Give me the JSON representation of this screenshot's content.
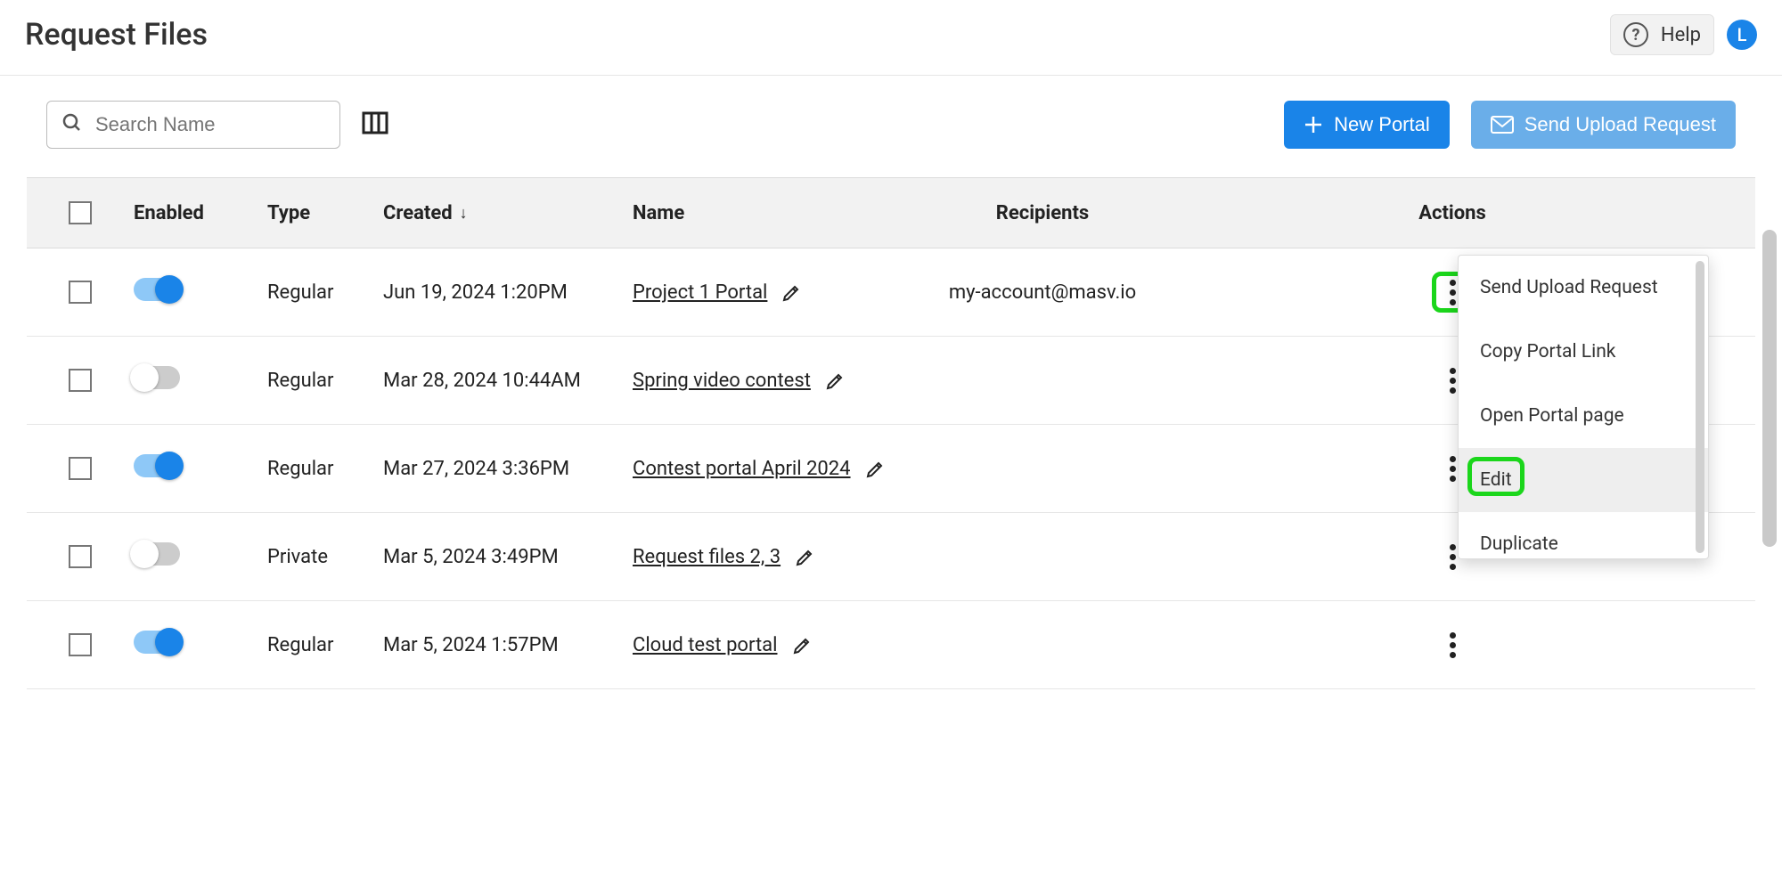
{
  "header": {
    "title": "Request Files",
    "help_label": "Help",
    "avatar_initial": "L"
  },
  "toolbar": {
    "search_placeholder": "Search Name",
    "new_portal": "New Portal",
    "send_upload": "Send Upload Request"
  },
  "table": {
    "columns": {
      "enabled": "Enabled",
      "type": "Type",
      "created": "Created",
      "name": "Name",
      "recipients": "Recipients",
      "actions": "Actions"
    },
    "rows": [
      {
        "enabled": true,
        "type": "Regular",
        "created": "Jun 19, 2024 1:20PM",
        "name": "Project 1 Portal",
        "recipients": "my-account@masv.io"
      },
      {
        "enabled": false,
        "type": "Regular",
        "created": "Mar 28, 2024 10:44AM",
        "name": "Spring video contest",
        "recipients": ""
      },
      {
        "enabled": true,
        "type": "Regular",
        "created": "Mar 27, 2024 3:36PM",
        "name": "Contest portal April 2024",
        "recipients": ""
      },
      {
        "enabled": false,
        "type": "Private",
        "created": "Mar 5, 2024 3:49PM",
        "name": "Request files 2, 3",
        "recipients": ""
      },
      {
        "enabled": true,
        "type": "Regular",
        "created": "Mar 5, 2024 1:57PM",
        "name": "Cloud test portal",
        "recipients": ""
      }
    ]
  },
  "menu": {
    "send_upload": "Send Upload Request",
    "copy_link": "Copy Portal Link",
    "open_page": "Open Portal page",
    "edit": "Edit",
    "duplicate": "Duplicate"
  }
}
